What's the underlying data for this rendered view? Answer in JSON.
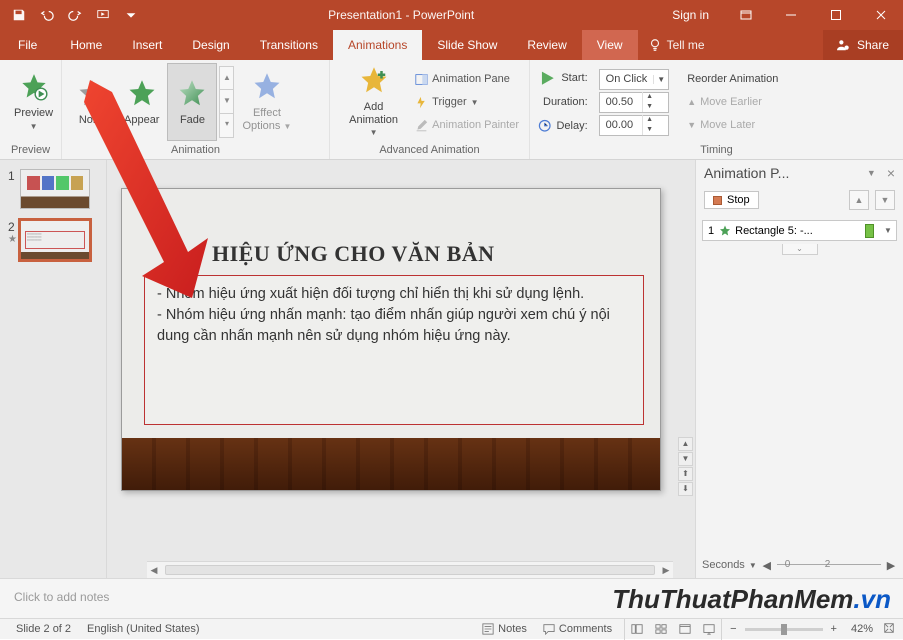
{
  "titlebar": {
    "title": "Presentation1 - PowerPoint",
    "signin": "Sign in"
  },
  "tabs": {
    "file": "File",
    "home": "Home",
    "insert": "Insert",
    "design": "Design",
    "transitions": "Transitions",
    "animations": "Animations",
    "slideshow": "Slide Show",
    "review": "Review",
    "view": "View",
    "tellme": "Tell me",
    "share": "Share"
  },
  "ribbon": {
    "preview": {
      "btn": "Preview",
      "group": "Preview"
    },
    "animation": {
      "none": "None",
      "appear": "Appear",
      "fade": "Fade",
      "effect_options": "Effect\nOptions",
      "group": "Animation"
    },
    "advanced": {
      "add": "Add\nAnimation",
      "pane": "Animation Pane",
      "trigger": "Trigger",
      "painter": "Animation Painter",
      "group": "Advanced Animation"
    },
    "timing": {
      "start": "Start:",
      "start_val": "On Click",
      "duration": "Duration:",
      "duration_val": "00.50",
      "delay": "Delay:",
      "delay_val": "00.00",
      "reorder": "Reorder Animation",
      "earlier": "Move Earlier",
      "later": "Move Later",
      "group": "Timing"
    }
  },
  "thumbs": {
    "n1": "1",
    "n2": "2",
    "star": "★"
  },
  "slide": {
    "title": "HIỆU ỨNG CHO VĂN BẢN",
    "p1": "- Nhóm hiệu ứng xuất hiện đối tượng chỉ hiển thị khi sử dụng lệnh.",
    "p2": "- Nhóm hiệu ứng nhấn mạnh: tạo điểm nhấn giúp người xem chú ý nội dung cần nhấn mạnh nên sử dụng nhóm hiệu ứng này."
  },
  "notes": {
    "placeholder": "Click to add notes"
  },
  "anim_pane": {
    "title": "Animation P...",
    "stop": "Stop",
    "item_num": "1",
    "item_text": "Rectangle 5: -...",
    "seconds": "Seconds",
    "t0": "0",
    "t2": "2"
  },
  "status": {
    "slide": "Slide 2 of 2",
    "lang": "English (United States)",
    "notes": "Notes",
    "comments": "Comments",
    "zoom": "42%",
    "plus": "+"
  },
  "watermark": {
    "a": "ThuThuatPhanMem",
    "b": ".vn"
  }
}
